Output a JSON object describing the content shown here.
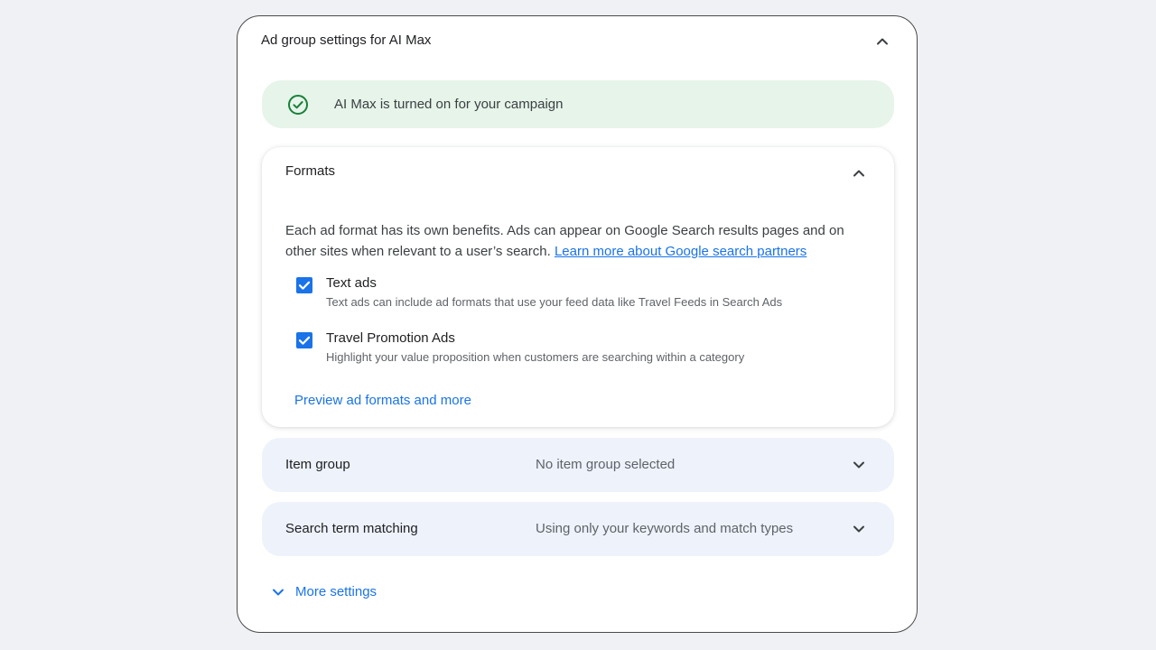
{
  "panel": {
    "title": "Ad group settings for AI Max"
  },
  "banner": {
    "text": "AI Max is turned on for your campaign",
    "icon": "check-circle-icon",
    "color": "#188038",
    "background": "#e6f4ea"
  },
  "formats": {
    "title": "Formats",
    "description": "Each ad format has its own benefits. Ads can appear on Google Search results pages and on other sites when relevant to a user’s search.",
    "learn_more_link": "Learn more about Google search partners",
    "options": [
      {
        "label": "Text ads",
        "sublabel": "Text ads can include ad formats that use your feed data like Travel Feeds in Search Ads",
        "checked": true
      },
      {
        "label": "Travel Promotion Ads",
        "sublabel": "Highlight your value proposition when customers are searching within a category",
        "checked": true
      }
    ],
    "preview_link": "Preview ad formats and more"
  },
  "rows": [
    {
      "label": "Item group",
      "value": "No item group selected"
    },
    {
      "label": "Search term matching",
      "value": "Using only your keywords and match types"
    }
  ],
  "more_settings": {
    "label": "More settings"
  },
  "colors": {
    "accent": "#1a73e8",
    "row_background": "#eef2fb",
    "page_background": "#eff1f4"
  }
}
